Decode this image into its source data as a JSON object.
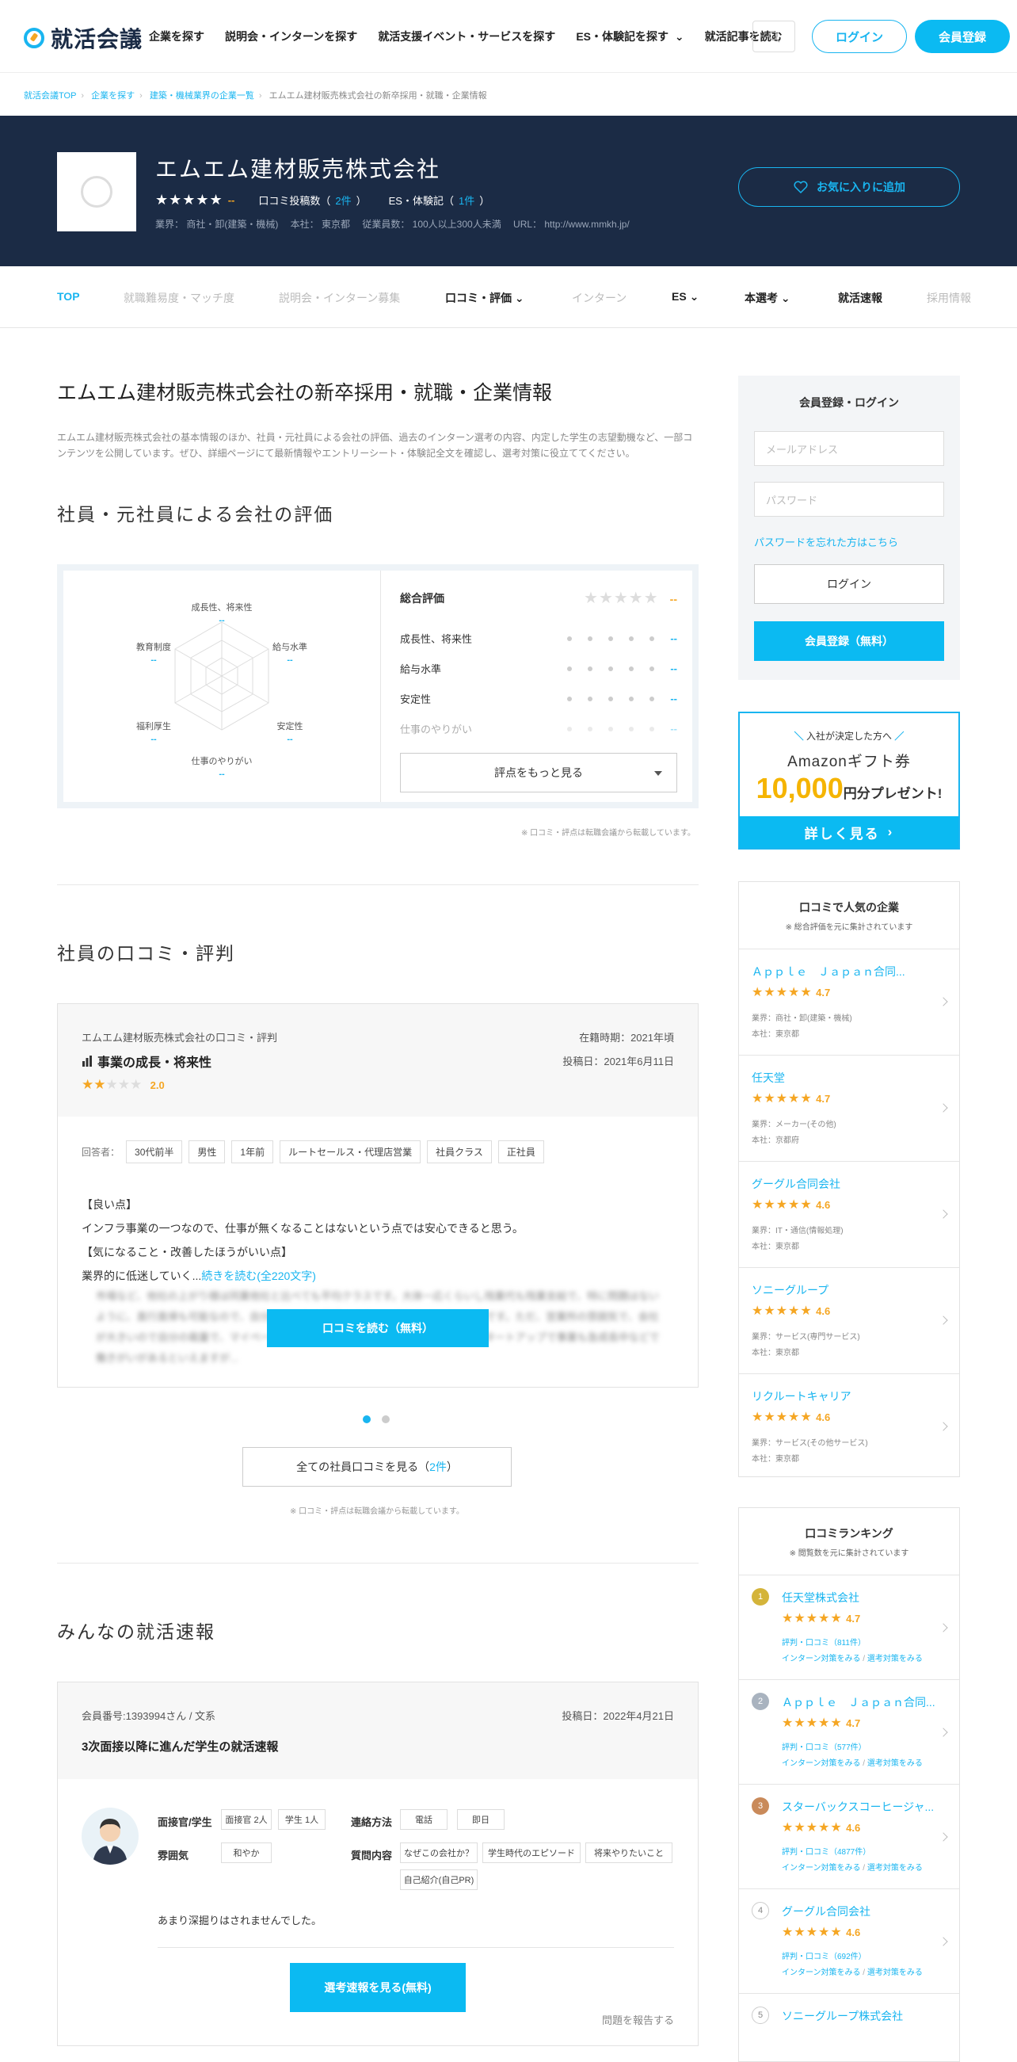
{
  "header": {
    "logo_text": "就活会議",
    "nav": [
      "企業を探す",
      "説明会・インターンを探す",
      "就活支援イベント・サービスを探す",
      "ES・体験記を探す",
      "就活記事を読む"
    ],
    "login": "ログイン",
    "register": "会員登録"
  },
  "breadcrumb": [
    "就活会議TOP",
    "企業を探す",
    "建築・機械業界の企業一覧",
    "エムエム建材販売株式会社の新卒採用・就職・企業情報"
  ],
  "company": {
    "name": "エムエム建材販売株式会社",
    "rating": "--",
    "review_label": "口コミ投稿数（",
    "review_count": "2件",
    "es_label": "ES・体験記（",
    "es_count": "1件",
    "close": "）",
    "info": "業界： 商社・卸(建築・機械)　 本社： 東京都　 従業員数： 100人以上300人未満　 URL： http://www.mmkh.jp/",
    "fav_button": "お気に入りに追加"
  },
  "subnav": [
    "TOP",
    "就職難易度・マッチ度",
    "説明会・インターン募集",
    "口コミ・評価",
    "インターン",
    "ES",
    "本選考",
    "就活速報",
    "採用情報"
  ],
  "main": {
    "title": "エムエム建材販売株式会社の新卒採用・就職・企業情報",
    "intro": "エムエム建材販売株式会社の基本情報のほか、社員・元社員による会社の評価、過去のインターン選考の内容、内定した学生の志望動機など、一部コンテンツを公開しています。ぜひ、詳細ページにて最新情報やエントリーシート・体験記全文を確認し、選考対策に役立ててください。",
    "eval_heading": "社員・元社員による会社の評価",
    "radar_labels": [
      "成長性、将来性",
      "給与水準",
      "安定性",
      "仕事のやりがい",
      "福利厚生",
      "教育制度"
    ],
    "radar_val": "--",
    "eval_total": "総合評価",
    "eval_rows": [
      "成長性、将来性",
      "給与水準",
      "安定性",
      "仕事のやりがい"
    ],
    "eval_more": "評点をもっと見る",
    "note": "※ 口コミ・評点は転職会議から転載しています。",
    "review_heading": "社員の口コミ・評判",
    "review": {
      "source": "エムエム建材販売株式会社の口コミ・評判",
      "period": "在籍時期：2021年頃",
      "topic": "事業の成長・将来性",
      "posted": "投稿日：2021年6月11日",
      "score": "2.0",
      "respondent_label": "回答者：",
      "tags": [
        "30代前半",
        "男性",
        "1年前",
        "ルートセールス・代理店営業",
        "社員クラス",
        "正社員"
      ],
      "good_head": "【良い点】",
      "good": "インフラ事業の一つなので、仕事が無くなることはないという点では安心できると思う。",
      "bad_head": "【気になること・改善したほうがいい点】",
      "bad": "業界的に低迷していく...",
      "more": "続きを読む(全220文字)",
      "blurred": "市場など、他社の上がり様は同業他社と比べても平均クラスです。大体一応くらいし残業代も残業支給で、特に問題はないように、直行直帰も可能なので、自分のペースで業績できるというわけではないようです。ただ、営業所の雰囲気で、会社が大きいので自分の裁量で、マイペースな仕事に不満もなく働いております。またスタートアップで事業も急成長中などで働きがいがあるといえますが...",
      "cta": "口コミを読む（無料）"
    },
    "all_reviews_prefix": "全ての社員口コミを見る（",
    "all_reviews_count": "2件",
    "all_reviews_suffix": "）",
    "news_heading": "みんなの就活速報",
    "news": {
      "member": "会員番号:1393994さん / 文系",
      "posted": "投稿日：2022年4月21日",
      "title": "3次面接以降に進んだ学生の就活速報",
      "l_interviewer": "面接官/学生",
      "t_interviewer": [
        "面接官 2人",
        "学生 1人"
      ],
      "l_contact": "連絡方法",
      "t_contact": [
        "電話",
        "即日"
      ],
      "l_mood": "雰囲気",
      "t_mood": [
        "和やか"
      ],
      "l_question": "質問内容",
      "t_question": [
        "なぜこの会社か？",
        "学生時代のエピソード",
        "将来やりたいこと",
        "自己紹介(自己PR)"
      ],
      "comment": "あまり深掘りはされませんでした。",
      "cta": "選考速報を見る(無料)",
      "report": "問題を報告する"
    }
  },
  "sidebar": {
    "login_title": "会員登録・ログイン",
    "email_ph": "メールアドレス",
    "password_ph": "パスワード",
    "forgot": "パスワードを忘れた方はこちら",
    "login": "ログイン",
    "register": "会員登録（無料）",
    "amazon": {
      "line1": "入社が決定した方へ",
      "line2": "Amazonギフト券",
      "amount": "10,000",
      "line3": "円分プレゼント!",
      "button": "詳しく見る"
    },
    "popular_title": "口コミで人気の企業",
    "popular_sub": "※ 総合評価を元に集計されています",
    "popular": [
      {
        "name": "Ａｐｐｌｅ　Ｊａｐａｎ合同...",
        "score": "4.7",
        "industry": "業界：商社・卸(建築・機械)",
        "hq": "本社：東京都"
      },
      {
        "name": "任天堂",
        "score": "4.7",
        "industry": "業界：メーカー(その他)",
        "hq": "本社：京都府"
      },
      {
        "name": "グーグル合同会社",
        "score": "4.6",
        "industry": "業界：IT・通信(情報処理)",
        "hq": "本社：東京都"
      },
      {
        "name": "ソニーグループ",
        "score": "4.6",
        "industry": "業界：サービス(専門サービス)",
        "hq": "本社：東京都"
      },
      {
        "name": "リクルートキャリア",
        "score": "4.6",
        "industry": "業界：サービス(その他サービス)",
        "hq": "本社：東京都"
      }
    ],
    "ranking_title": "口コミランキング",
    "ranking_sub": "※ 閲覧数を元に集計されています",
    "ranking": [
      {
        "rank": "1",
        "name": "任天堂株式会社",
        "score": "4.7",
        "reviews": "評判・口コミ（811件）",
        "color": "#d4b43a"
      },
      {
        "rank": "2",
        "name": "Ａｐｐｌｅ　Ｊａｐａｎ合同...",
        "score": "4.7",
        "reviews": "評判・口コミ（577件）",
        "color": "#a9b3bf"
      },
      {
        "rank": "3",
        "name": "スターバックスコーヒージャ...",
        "score": "4.6",
        "reviews": "評判・口コミ（4877件）",
        "color": "#c98a5a"
      },
      {
        "rank": "4",
        "name": "グーグル合同会社",
        "score": "4.6",
        "reviews": "評判・口コミ（692件）",
        "color": "#ffffff"
      },
      {
        "rank": "5",
        "name": "ソニーグループ株式会社",
        "score": "",
        "reviews": "",
        "color": "#ffffff"
      }
    ],
    "intern_link": "インターン対策をみる",
    "select_link": "選考対策をみる",
    "link_sep": "/"
  },
  "colors": {
    "accent": "#0bbaf2",
    "navy": "#1b2b45",
    "star": "#f5a623"
  }
}
